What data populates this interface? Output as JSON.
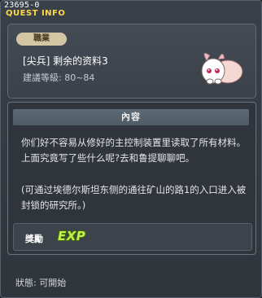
{
  "window": {
    "quest_id": "23695-0",
    "title": "QUEST INFO"
  },
  "job_panel": {
    "badge": "職業",
    "quest_name": "[尖兵] 剩余的资料3",
    "level_range": "建議等級: 80~84"
  },
  "content": {
    "header": "內容",
    "paragraph1": "你们好不容易从修好的主控制装置里读取了所有材料。上面究竟写了些什么呢?去和鲁提聊聊吧。",
    "paragraph2": "(可通过埃德尔斯坦东侧的通往矿山的路1的入口进入被封锁的研究所。)"
  },
  "reward": {
    "label": "獎勵",
    "exp_text": "EXP"
  },
  "status": {
    "text": "狀態: 可開始"
  },
  "colors": {
    "title": "#ffd84a",
    "exp": "#c8f04a",
    "badge_bg": "#d4c5a3"
  },
  "icons": {
    "npc": "pink-rabbit-creature-icon"
  }
}
